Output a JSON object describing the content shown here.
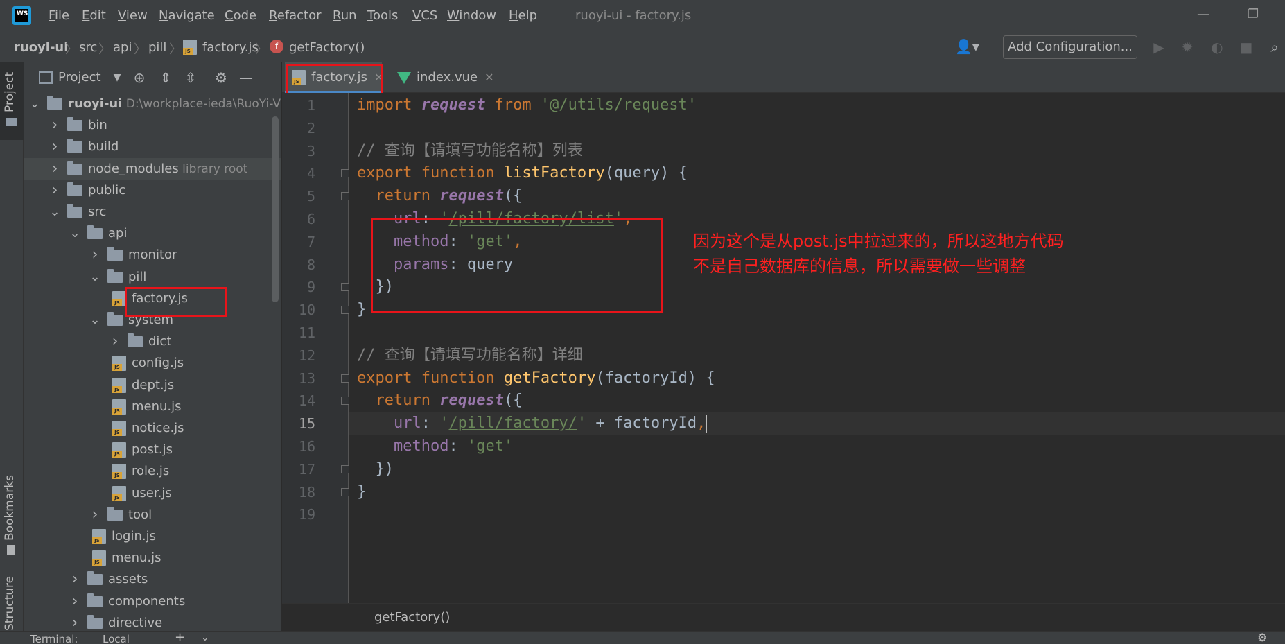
{
  "window": {
    "title": "ruoyi-ui - factory.js",
    "menu": [
      "File",
      "Edit",
      "View",
      "Navigate",
      "Code",
      "Refactor",
      "Run",
      "Tools",
      "VCS",
      "Window",
      "Help"
    ],
    "logo_text": "WS"
  },
  "navbar": {
    "breadcrumbs": [
      "ruoyi-ui",
      "src",
      "api",
      "pill",
      "factory.js",
      "getFactory()"
    ],
    "add_configuration": "Add Configuration..."
  },
  "left_stripe": {
    "project": "Project",
    "bookmarks": "Bookmarks",
    "structure": "Structure"
  },
  "project_panel": {
    "title": "Project",
    "tree": [
      {
        "label": "ruoyi-ui",
        "path": "D:\\workplace-ieda\\RuoYi-Vu",
        "depth": 0,
        "type": "folder",
        "expanded": true
      },
      {
        "label": "bin",
        "depth": 1,
        "type": "folder",
        "expanded": false
      },
      {
        "label": "build",
        "depth": 1,
        "type": "folder",
        "expanded": false
      },
      {
        "label": "node_modules",
        "suffix": "library root",
        "depth": 1,
        "type": "folder",
        "expanded": false
      },
      {
        "label": "public",
        "depth": 1,
        "type": "folder",
        "expanded": false
      },
      {
        "label": "src",
        "depth": 1,
        "type": "folder",
        "expanded": true
      },
      {
        "label": "api",
        "depth": 2,
        "type": "folder",
        "expanded": true
      },
      {
        "label": "monitor",
        "depth": 3,
        "type": "folder",
        "expanded": false
      },
      {
        "label": "pill",
        "depth": 3,
        "type": "folder",
        "expanded": true
      },
      {
        "label": "factory.js",
        "depth": 4,
        "type": "js"
      },
      {
        "label": "system",
        "depth": 3,
        "type": "folder",
        "expanded": true
      },
      {
        "label": "dict",
        "depth": 4,
        "type": "folder",
        "expanded": false
      },
      {
        "label": "config.js",
        "depth": 4,
        "type": "js"
      },
      {
        "label": "dept.js",
        "depth": 4,
        "type": "js"
      },
      {
        "label": "menu.js",
        "depth": 4,
        "type": "js"
      },
      {
        "label": "notice.js",
        "depth": 4,
        "type": "js"
      },
      {
        "label": "post.js",
        "depth": 4,
        "type": "js"
      },
      {
        "label": "role.js",
        "depth": 4,
        "type": "js"
      },
      {
        "label": "user.js",
        "depth": 4,
        "type": "js"
      },
      {
        "label": "tool",
        "depth": 3,
        "type": "folder",
        "expanded": false
      },
      {
        "label": "login.js",
        "depth": 3,
        "type": "js"
      },
      {
        "label": "menu.js",
        "depth": 3,
        "type": "js"
      },
      {
        "label": "assets",
        "depth": 2,
        "type": "folder",
        "expanded": false
      },
      {
        "label": "components",
        "depth": 2,
        "type": "folder",
        "expanded": false
      },
      {
        "label": "directive",
        "depth": 2,
        "type": "folder",
        "expanded": false
      }
    ]
  },
  "editor": {
    "tabs": [
      {
        "label": "factory.js",
        "active": true
      },
      {
        "label": "index.vue",
        "active": false
      }
    ],
    "current_line": 15,
    "lines": [
      {
        "n": "1",
        "tokens": [
          [
            "kw",
            "import "
          ],
          [
            "req",
            "request"
          ],
          [
            "kw",
            " from "
          ],
          [
            "str",
            "'@/utils/request'"
          ]
        ]
      },
      {
        "n": "2",
        "tokens": []
      },
      {
        "n": "3",
        "tokens": [
          [
            "cmt",
            "// 查询【请填写功能名称】列表"
          ]
        ]
      },
      {
        "n": "4",
        "tokens": [
          [
            "kw",
            "export function "
          ],
          [
            "fn",
            "listFactory"
          ],
          [
            "",
            "(query) {"
          ]
        ]
      },
      {
        "n": "5",
        "tokens": [
          [
            "kw",
            "  return "
          ],
          [
            "req",
            "request"
          ],
          [
            "",
            "({"
          ]
        ]
      },
      {
        "n": "6",
        "tokens": [
          [
            "prop",
            "    url"
          ],
          [
            "",
            ": "
          ],
          [
            "str",
            "'"
          ],
          [
            "strlink",
            "/pill/factory/list"
          ],
          [
            "str",
            "'"
          ],
          [
            "kw",
            ","
          ]
        ]
      },
      {
        "n": "7",
        "tokens": [
          [
            "prop",
            "    method"
          ],
          [
            "",
            ": "
          ],
          [
            "str",
            "'get'"
          ],
          [
            "kw",
            ","
          ]
        ]
      },
      {
        "n": "8",
        "tokens": [
          [
            "prop",
            "    params"
          ],
          [
            "",
            ": query"
          ]
        ]
      },
      {
        "n": "9",
        "tokens": [
          [
            "",
            "  })"
          ]
        ]
      },
      {
        "n": "10",
        "tokens": [
          [
            "",
            "}"
          ]
        ]
      },
      {
        "n": "11",
        "tokens": []
      },
      {
        "n": "12",
        "tokens": [
          [
            "cmt",
            "// 查询【请填写功能名称】详细"
          ]
        ]
      },
      {
        "n": "13",
        "tokens": [
          [
            "kw",
            "export function "
          ],
          [
            "fn",
            "getFactory"
          ],
          [
            "",
            "(factoryId) {"
          ]
        ]
      },
      {
        "n": "14",
        "tokens": [
          [
            "kw",
            "  return "
          ],
          [
            "req",
            "request"
          ],
          [
            "",
            "({"
          ]
        ]
      },
      {
        "n": "15",
        "tokens": [
          [
            "prop",
            "    url"
          ],
          [
            "",
            ": "
          ],
          [
            "str",
            "'"
          ],
          [
            "strlink",
            "/pill/factory/"
          ],
          [
            "str",
            "'"
          ],
          [
            "",
            " + factoryId"
          ],
          [
            "kw",
            ","
          ]
        ]
      },
      {
        "n": "16",
        "tokens": [
          [
            "prop",
            "    method"
          ],
          [
            "",
            ": "
          ],
          [
            "str",
            "'get'"
          ]
        ]
      },
      {
        "n": "17",
        "tokens": [
          [
            "",
            "  })"
          ]
        ]
      },
      {
        "n": "18",
        "tokens": [
          [
            "",
            "}"
          ]
        ]
      },
      {
        "n": "19",
        "tokens": []
      }
    ],
    "breadcrumb": "getFactory()"
  },
  "annotation": {
    "line1": "因为这个是从post.js中拉过来的，所以这地方代码",
    "line2": "不是自己数据库的信息，所以需要做一些调整"
  },
  "bottom": {
    "terminal": "Terminal:",
    "local": "Local"
  },
  "colors": {
    "keyword": "#cc7832",
    "function": "#ffc66d",
    "string": "#6a8759",
    "property": "#9876aa",
    "comment": "#808080",
    "annotation": "#e8141a"
  }
}
